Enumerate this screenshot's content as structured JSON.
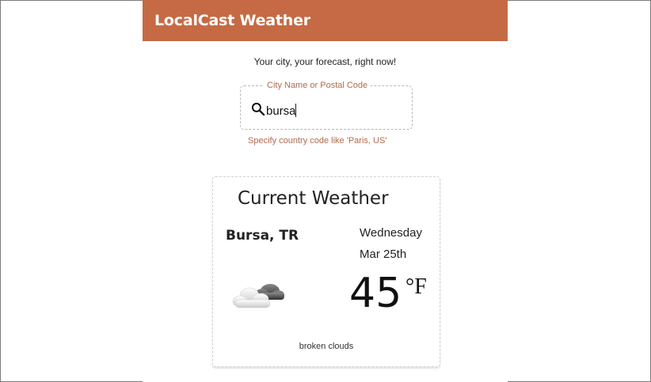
{
  "app": {
    "title": "LocalCast Weather",
    "tagline": "Your city, your forecast, right now!",
    "accent_color": "#c56a44"
  },
  "search": {
    "label": "City Name or Postal Code",
    "value": "bursa",
    "hint": "Specify country code like 'Paris, US'",
    "icon": "search-icon"
  },
  "current_weather": {
    "title": "Current Weather",
    "city": "Bursa, TR",
    "day": "Wednesday",
    "date": "Mar 25th",
    "temperature": "45",
    "unit": "°F",
    "icon": "broken-clouds-icon",
    "description": "broken clouds"
  }
}
